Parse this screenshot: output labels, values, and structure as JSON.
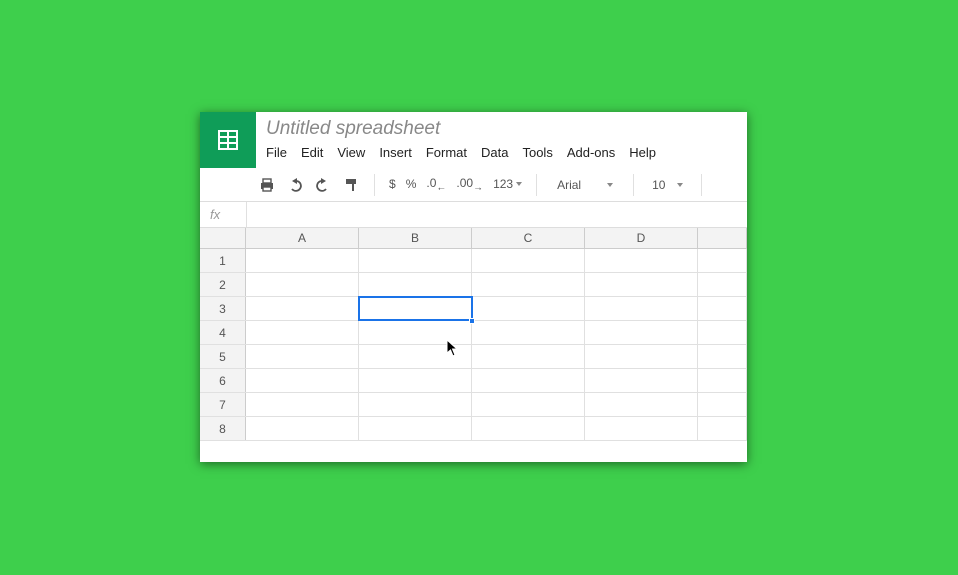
{
  "title": "Untitled spreadsheet",
  "menu": {
    "items": [
      "File",
      "Edit",
      "View",
      "Insert",
      "Format",
      "Data",
      "Tools",
      "Add-ons",
      "Help"
    ]
  },
  "toolbar": {
    "currency": "$",
    "percent": "%",
    "dec_dn": ".0",
    "dec_up": ".00",
    "numfmt": "123",
    "font": "Arial",
    "fontsize": "10"
  },
  "fx": {
    "label": "fx",
    "value": ""
  },
  "columns": [
    "A",
    "B",
    "C",
    "D"
  ],
  "rows": [
    "1",
    "2",
    "3",
    "4",
    "5",
    "6",
    "7",
    "8"
  ],
  "selected": {
    "row": 2,
    "col": 1
  },
  "chart_data": {
    "type": "table",
    "columns": [
      "A",
      "B",
      "C",
      "D"
    ],
    "rows": [
      [
        "",
        "",
        "",
        ""
      ],
      [
        "",
        "",
        "",
        ""
      ],
      [
        "",
        "",
        "",
        ""
      ],
      [
        "",
        "",
        "",
        ""
      ],
      [
        "",
        "",
        "",
        ""
      ],
      [
        "",
        "",
        "",
        ""
      ],
      [
        "",
        "",
        "",
        ""
      ],
      [
        "",
        "",
        "",
        ""
      ]
    ],
    "active_cell": "B3"
  }
}
